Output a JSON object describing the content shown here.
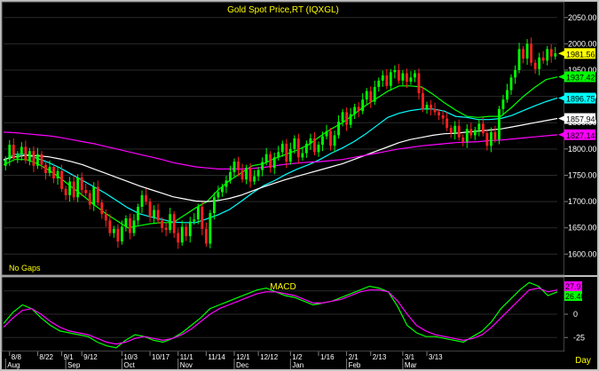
{
  "chart_data": {
    "type": "candlestick",
    "title": "Gold Spot Price,RT (IQXGL)",
    "note": "No Gaps",
    "x_label": "Day",
    "price_axis": {
      "ylim": [
        1560,
        2080
      ],
      "ticks": [
        1600,
        1650,
        1700,
        1750,
        1800,
        1850,
        1900,
        1950,
        2000,
        2050
      ],
      "tick_labels": [
        "1600.00",
        "1650.00",
        "1700.00",
        "1750.00",
        "1800.00",
        "1850.00",
        "1900.00",
        "1950.00",
        "2000.00",
        "2050.00"
      ]
    },
    "price_labels": [
      {
        "text": "1981.56",
        "value": 1981.56,
        "color": "#ffff00"
      },
      {
        "text": "1937.42",
        "value": 1937.42,
        "color": "#00ff00"
      },
      {
        "text": "1896.75",
        "value": 1896.75,
        "color": "#00ffff"
      },
      {
        "text": "1857.94",
        "value": 1857.94,
        "color": "#ffffff"
      },
      {
        "text": "1827.14",
        "value": 1827.14,
        "color": "#ff00ff"
      }
    ],
    "candles": [
      1780,
      1808,
      1782,
      1790,
      1804,
      1778,
      1796,
      1768,
      1790,
      1770,
      1754,
      1766,
      1744,
      1758,
      1724,
      1712,
      1738,
      1708,
      1746,
      1722,
      1716,
      1694,
      1728,
      1698,
      1676,
      1664,
      1640,
      1648,
      1624,
      1652,
      1668,
      1640,
      1664,
      1690,
      1712,
      1700,
      1670,
      1684,
      1664,
      1650,
      1646,
      1676,
      1640,
      1622,
      1652,
      1634,
      1662,
      1666,
      1690,
      1648,
      1620,
      1678,
      1708,
      1718,
      1728,
      1740,
      1756,
      1776,
      1760,
      1742,
      1764,
      1738,
      1748,
      1760,
      1775,
      1790,
      1764,
      1784,
      1794,
      1810,
      1776,
      1800,
      1820,
      1784,
      1792,
      1810,
      1820,
      1794,
      1808,
      1824,
      1834,
      1806,
      1826,
      1852,
      1870,
      1846,
      1866,
      1880,
      1872,
      1894,
      1910,
      1890,
      1918,
      1930,
      1940,
      1920,
      1946,
      1950,
      1930,
      1944,
      1928,
      1936,
      1944,
      1906,
      1876,
      1884,
      1876,
      1870,
      1864,
      1858,
      1840,
      1830,
      1844,
      1822,
      1814,
      1838,
      1826,
      1836,
      1848,
      1830,
      1806,
      1832,
      1818,
      1876,
      1894,
      1912,
      1936,
      1950,
      1990,
      1972,
      2000,
      1964,
      1952,
      1974,
      1968,
      1990,
      1976,
      1982
    ],
    "first_close": 1768,
    "moving_averages": [
      {
        "color": "#00ff00",
        "final": 1937.42,
        "values": [
          1770,
          1780,
          1780,
          1772,
          1760,
          1745,
          1728,
          1712,
          1694,
          1678,
          1664,
          1650,
          1654,
          1658,
          1660,
          1660,
          1674,
          1688,
          1700,
          1722,
          1740,
          1754,
          1768,
          1772,
          1782,
          1790,
          1798,
          1808,
          1824,
          1838,
          1850,
          1866,
          1882,
          1896,
          1910,
          1920,
          1920,
          1918,
          1904,
          1888,
          1874,
          1862,
          1860,
          1862,
          1862,
          1880,
          1900,
          1917,
          1932,
          1937
        ]
      },
      {
        "color": "#00ffff",
        "final": 1896.75,
        "values": [
          1778,
          1790,
          1790,
          1782,
          1774,
          1764,
          1752,
          1740,
          1728,
          1716,
          1702,
          1688,
          1677,
          1671,
          1666,
          1661,
          1660,
          1660,
          1667,
          1675,
          1685,
          1700,
          1716,
          1730,
          1740,
          1752,
          1762,
          1770,
          1780,
          1792,
          1802,
          1814,
          1828,
          1844,
          1860,
          1868,
          1873,
          1876,
          1876,
          1872,
          1862,
          1860,
          1856,
          1856,
          1858,
          1864,
          1873,
          1882,
          1890,
          1897
        ]
      },
      {
        "color": "#ffffff",
        "final": 1857.94,
        "values": [
          1780,
          1785,
          1788,
          1787,
          1785,
          1781,
          1776,
          1770,
          1762,
          1754,
          1746,
          1738,
          1730,
          1723,
          1716,
          1709,
          1705,
          1701,
          1700,
          1702,
          1706,
          1712,
          1720,
          1728,
          1735,
          1742,
          1748,
          1754,
          1760,
          1766,
          1772,
          1780,
          1788,
          1796,
          1804,
          1812,
          1818,
          1822,
          1826,
          1829,
          1830,
          1832,
          1834,
          1836,
          1838,
          1842,
          1846,
          1850,
          1854,
          1858
        ]
      },
      {
        "color": "#ff00ff",
        "final": 1827.14,
        "values": [
          1832,
          1831,
          1829,
          1827,
          1825,
          1822,
          1818,
          1814,
          1810,
          1805,
          1800,
          1795,
          1790,
          1785,
          1780,
          1774,
          1770,
          1766,
          1764,
          1762,
          1762,
          1762,
          1763,
          1765,
          1768,
          1771,
          1773,
          1775,
          1776,
          1778,
          1780,
          1784,
          1788,
          1792,
          1796,
          1800,
          1803,
          1806,
          1808,
          1810,
          1812,
          1813,
          1814,
          1816,
          1817,
          1819,
          1821,
          1823,
          1825,
          1827
        ]
      }
    ],
    "x_ticks_top": [
      "8/8",
      "8/22",
      "9/1",
      "9/12",
      "10/3",
      "10/17",
      "11/1",
      "11/14",
      "12/1",
      "12/12",
      "1/2",
      "1/16",
      "2/1",
      "2/13",
      "3/1",
      "3/13"
    ],
    "x_ticks_top_index": [
      1,
      8,
      14,
      19,
      29,
      36,
      43,
      50,
      57,
      63,
      71,
      78,
      85,
      91,
      99,
      105
    ],
    "x_ticks_bottom": [
      "Aug",
      "Sep",
      "Oct",
      "Nov",
      "Dec",
      "Jan",
      "Feb",
      "Mar"
    ],
    "x_ticks_bottom_index": [
      0,
      15,
      29,
      43,
      57,
      71,
      85,
      99
    ],
    "macd": {
      "title": "MACD",
      "ylim": [
        -40,
        40
      ],
      "ticks": [
        -25,
        0,
        25
      ],
      "tick_labels": [
        "-25",
        "0",
        "25"
      ],
      "labels": [
        {
          "text": "27.91",
          "value": 27.91,
          "color": "#ff00ff"
        },
        {
          "text": "26.40",
          "value": 26.4,
          "color": "#00ff00"
        }
      ],
      "series": [
        {
          "color": "#00ff00",
          "values": [
            -10,
            2,
            10,
            6,
            -4,
            -12,
            -18,
            -20,
            -22,
            -24,
            -30,
            -34,
            -36,
            -28,
            -22,
            -24,
            -28,
            -30,
            -26,
            -20,
            -12,
            -4,
            6,
            10,
            14,
            18,
            22,
            26,
            28,
            24,
            20,
            18,
            14,
            10,
            12,
            14,
            18,
            22,
            26,
            30,
            28,
            24,
            8,
            -12,
            -20,
            -24,
            -24,
            -26,
            -28,
            -30,
            -24,
            -18,
            -8,
            6,
            16,
            26,
            34,
            30,
            20,
            24
          ]
        },
        {
          "color": "#ff00ff",
          "values": [
            -14,
            -4,
            4,
            6,
            0,
            -8,
            -14,
            -18,
            -20,
            -22,
            -26,
            -30,
            -32,
            -30,
            -26,
            -24,
            -26,
            -28,
            -26,
            -22,
            -16,
            -8,
            0,
            6,
            10,
            14,
            18,
            22,
            24,
            24,
            22,
            20,
            16,
            12,
            12,
            14,
            16,
            20,
            24,
            26,
            26,
            24,
            14,
            0,
            -12,
            -18,
            -22,
            -24,
            -26,
            -28,
            -26,
            -22,
            -14,
            -4,
            6,
            16,
            26,
            28,
            24,
            26
          ]
        }
      ]
    }
  }
}
